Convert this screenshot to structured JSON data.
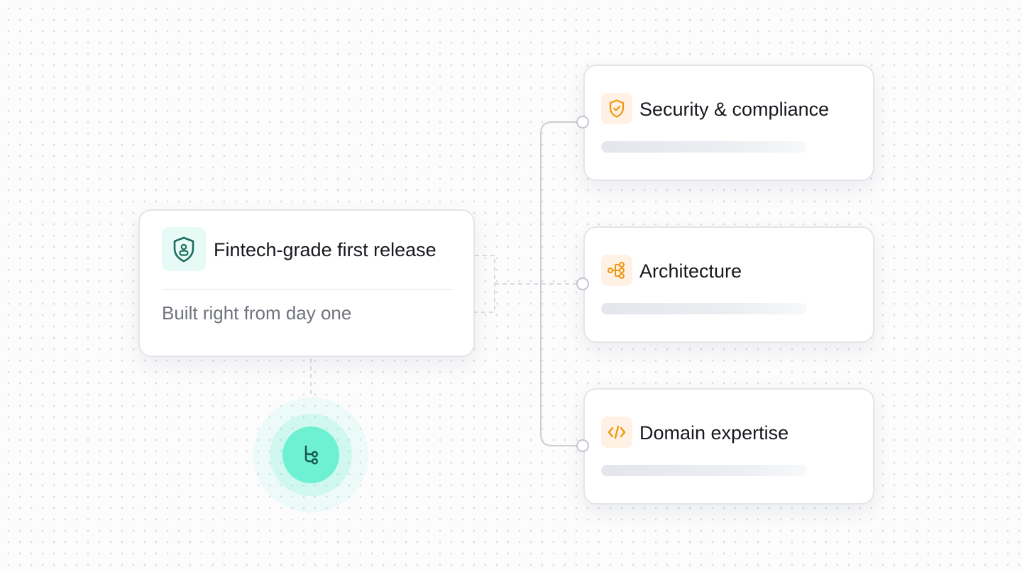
{
  "main_card": {
    "title": "Fintech-grade first release",
    "subtitle": "Built right from day one",
    "icon": "shield-user-icon"
  },
  "branches": [
    {
      "title": "Security & compliance",
      "icon": "shield-check-icon"
    },
    {
      "title": "Architecture",
      "icon": "hierarchy-icon"
    },
    {
      "title": "Domain expertise",
      "icon": "code-icon"
    }
  ],
  "hub": {
    "icon": "git-branch-icon"
  },
  "colors": {
    "accent_teal": "#6ef0d2",
    "teal_icon": "#1d6b5f",
    "orange_icon": "#f0960f",
    "orange_bg": "#fff1e3",
    "connector": "#c9ccd2"
  }
}
